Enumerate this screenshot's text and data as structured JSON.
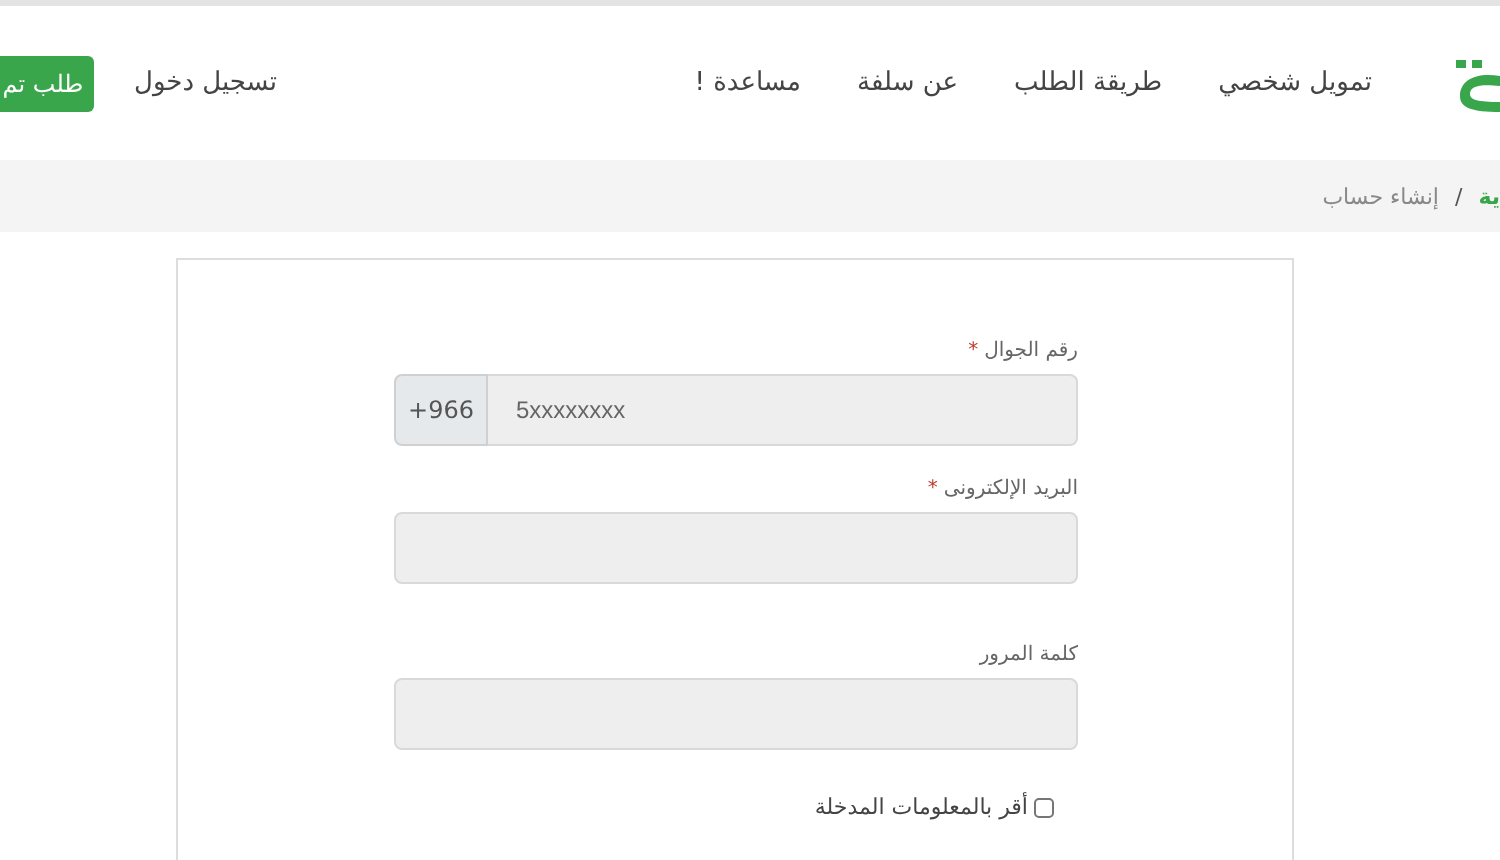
{
  "header": {
    "nav": [
      "تمويل شخصي",
      "طريقة الطلب",
      "عن سلفة",
      "مساعدة !"
    ],
    "login": "تسجيل دخول",
    "cta": "طلب تم"
  },
  "breadcrumb": {
    "separator": "/",
    "items": [
      {
        "label": "ية",
        "current": false
      },
      {
        "label": "إنشاء حساب",
        "current": true
      }
    ]
  },
  "form": {
    "required_mark": "*",
    "fields": [
      {
        "label": "رقم الجوال",
        "required": true,
        "prefix": "+966",
        "placeholder": "5xxxxxxxx"
      },
      {
        "label": "البريد الإلكترونى",
        "required": true
      },
      {
        "label": "كلمة المرور",
        "required": false
      }
    ],
    "agree": {
      "label": "أقر بالمعلومات المدخلة",
      "checked": false
    }
  }
}
